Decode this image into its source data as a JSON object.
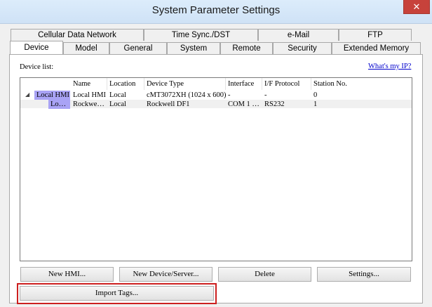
{
  "window": {
    "title": "System Parameter Settings",
    "close_glyph": "✕"
  },
  "tabs_back": [
    "Cellular Data Network",
    "Time Sync./DST",
    "e-Mail",
    "FTP"
  ],
  "tabs_front": [
    "Device",
    "Model",
    "General",
    "System",
    "Remote",
    "Security",
    "Extended Memory"
  ],
  "active_tab": "Device",
  "device_list": {
    "label": "Device list:",
    "help_link": "What's my IP?",
    "columns": [
      "Name",
      "Location",
      "Device Type",
      "Interface",
      "I/F Protocol",
      "Station No."
    ],
    "rows": [
      {
        "group": "Local HMI",
        "name": "Local HMI",
        "location": "Local",
        "device_type": "cMT3072XH (1024 x 600)",
        "interface": "-",
        "protocol": "-",
        "station": "0"
      },
      {
        "group": "Lo…",
        "name": "Rockwe…",
        "location": "Local",
        "device_type": "Rockwell DF1",
        "interface": "COM 1 …",
        "protocol": "RS232",
        "station": "1"
      }
    ]
  },
  "buttons": {
    "new_hmi": "New HMI...",
    "new_device": "New Device/Server...",
    "delete": "Delete",
    "settings": "Settings...",
    "import_tags": "Import Tags..."
  },
  "colors": {
    "highlight": "#cc1f1f",
    "group_badge": "#a9a3f5",
    "link": "#0000cc"
  }
}
